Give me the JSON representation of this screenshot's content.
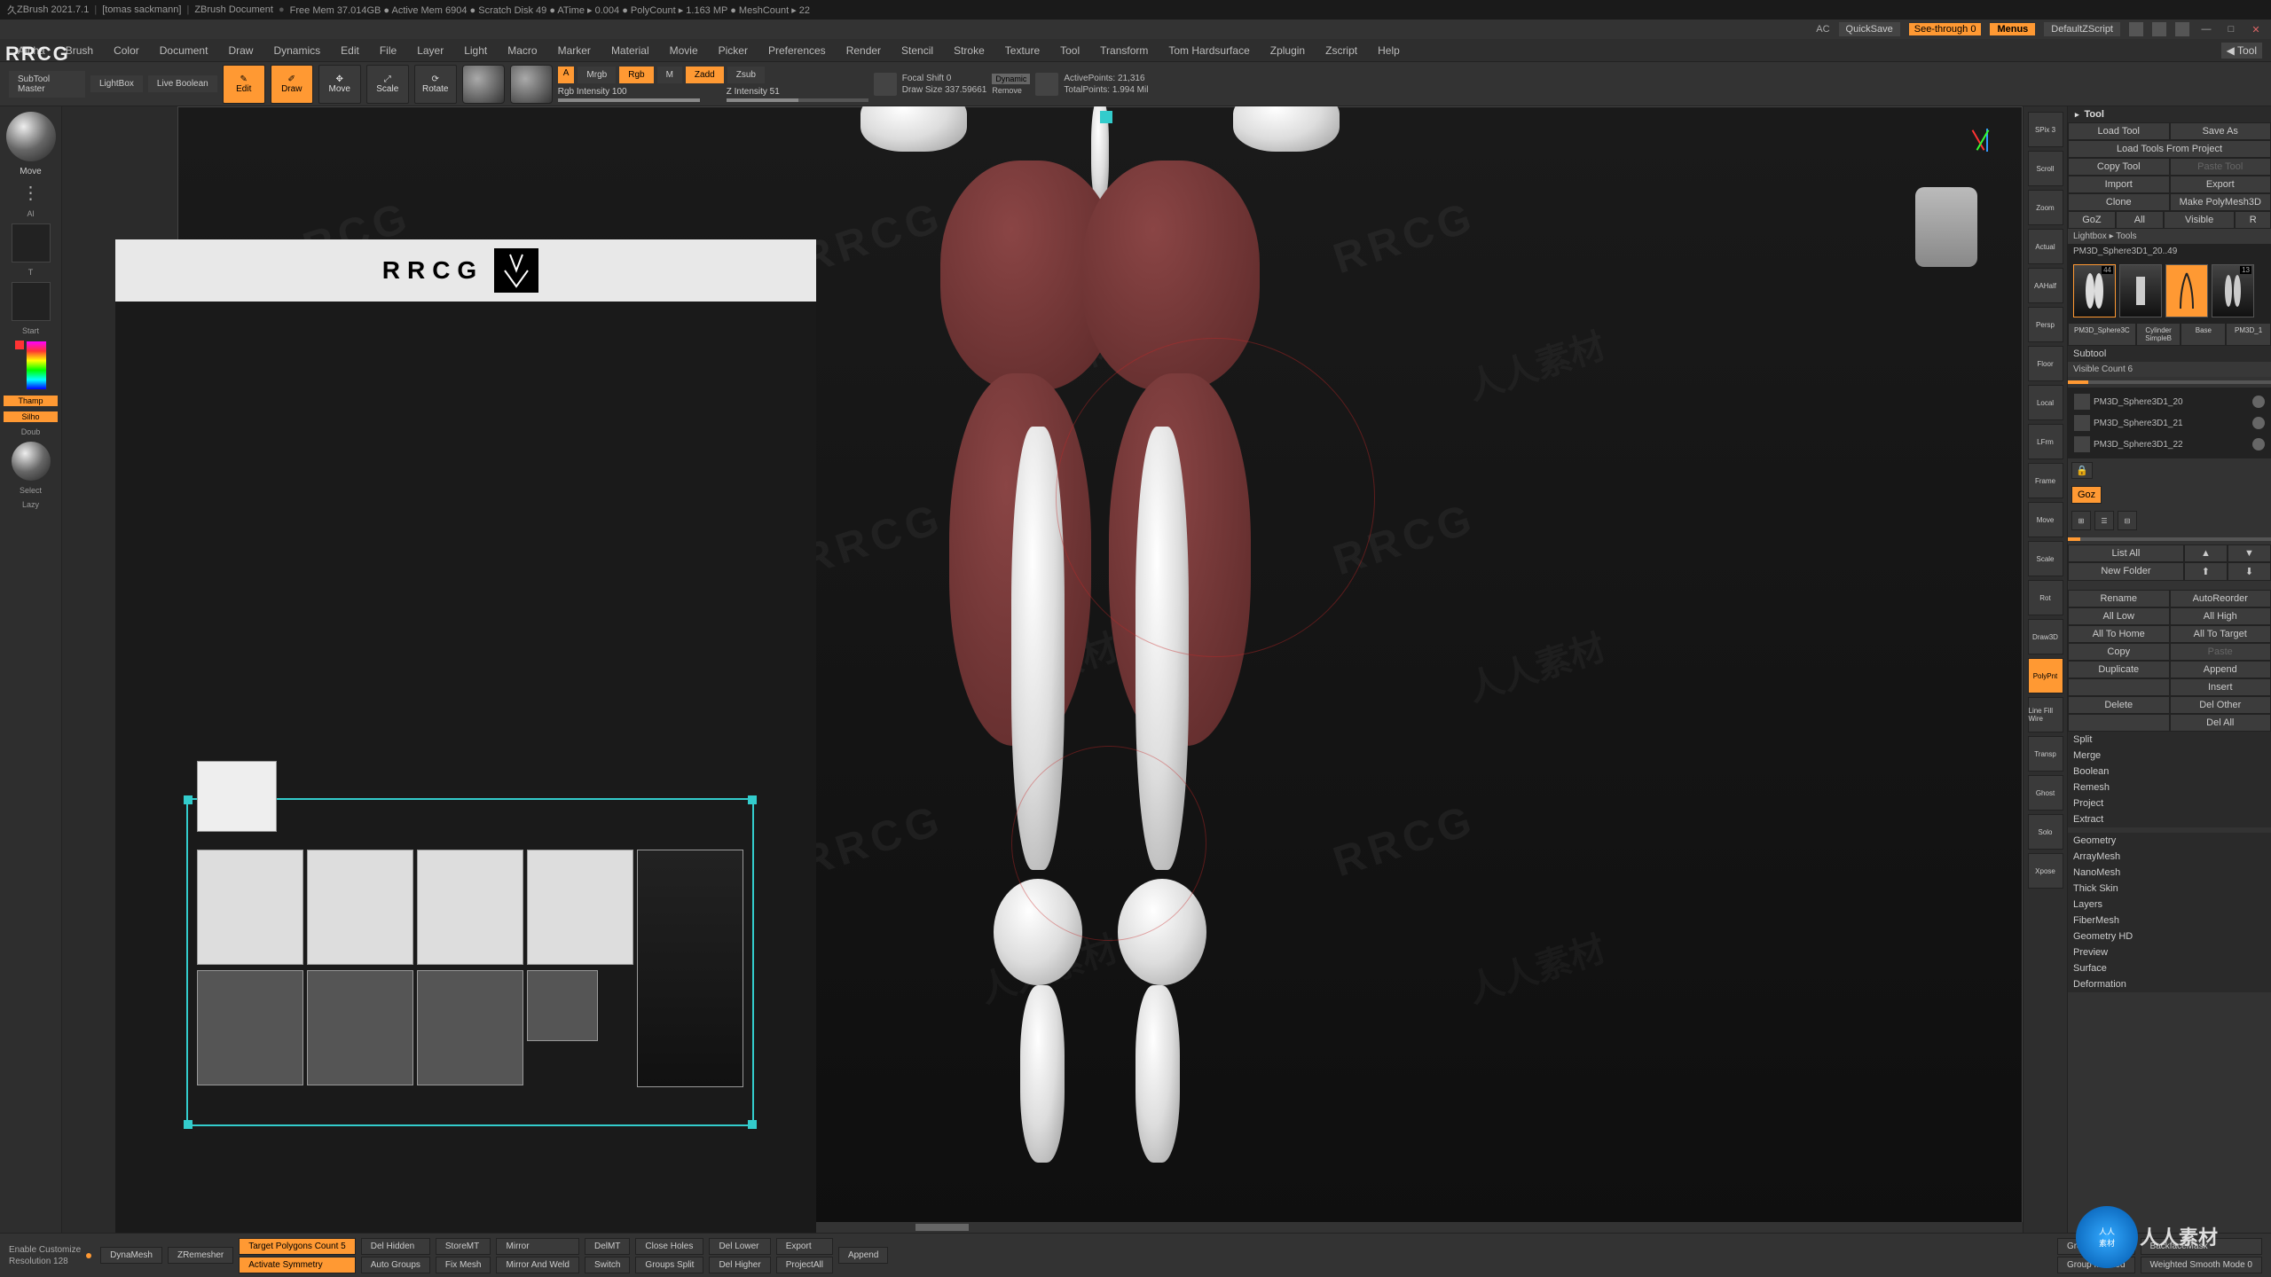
{
  "titlebar": {
    "app": "ZBrush 2021.7.1",
    "user": "[tomas sackmann]",
    "doc": "ZBrush Document",
    "stats": "Free Mem 37.014GB ● Active Mem 6904 ● Scratch Disk 49 ● ATime ▸ 0.004 ● PolyCount ▸ 1.163 MP ● MeshCount ▸ 22"
  },
  "topstrip": {
    "ac": "AC",
    "quicksave": "QuickSave",
    "seethrough": "See-through  0",
    "menus": "Menus",
    "default": "DefaultZScript"
  },
  "menubar": [
    "Alpha",
    "Brush",
    "Color",
    "Document",
    "Draw",
    "Dynamics",
    "Edit",
    "File",
    "Layer",
    "Light",
    "Macro",
    "Marker",
    "Material",
    "Movie",
    "Picker",
    "Preferences",
    "Render",
    "Stencil",
    "Stroke",
    "Texture",
    "Tool",
    "Transform",
    "Tom Hardsurface",
    "Zplugin",
    "Zscript",
    "Help"
  ],
  "menuright": {
    "tool": "Tool"
  },
  "toolrow": {
    "subtoolmaster": "SubTool\nMaster",
    "lightbox": "LightBox",
    "liveboolean": "Live Boolean",
    "edit": "Edit",
    "draw": "Draw",
    "move": "Move",
    "scale": "Scale",
    "rotate": "Rotate",
    "mrgb": "Mrgb",
    "rgb": "Rgb",
    "m": "M",
    "zadd": "Zadd",
    "zsub": "Zsub",
    "a": "A",
    "rgbintensity": "Rgb Intensity 100",
    "zintensity": "Z Intensity 51",
    "focalshift": "Focal Shift 0",
    "drawsize": "Draw Size 337.59661",
    "dynamic": "Dynamic",
    "remove": "Remove",
    "activepoints": "ActivePoints: 21,316",
    "totalpoints": "TotalPoints: 1.994 Mil"
  },
  "watermarks": {
    "rrcg": "RRCG",
    "cn": "人人素材"
  },
  "left": {
    "brush": "Move",
    "al": "Al",
    "t": "T",
    "start": "Start",
    "thamp": "Thamp",
    "silho": "Silho",
    "doub": "Doub",
    "select": "Select",
    "lazy": "Lazy"
  },
  "riconcol": [
    "SPix 3",
    "Scroll",
    "Zoom",
    "Actual",
    "AAHalf",
    "Persp",
    "Floor",
    "Local",
    "LFrm",
    "Frame",
    "Move",
    "Scale",
    "Rot",
    "Draw3D",
    "PolyPnt",
    "Line Fill Wire",
    "Transp",
    "Ghost",
    "Solo",
    "Xpose"
  ],
  "riconcol_active": [
    14
  ],
  "rpanel": {
    "title": "Tool",
    "row1": [
      "Load Tool",
      "Save As"
    ],
    "row2": [
      "Load Tools From Project"
    ],
    "row3": [
      "Copy Tool",
      "Paste Tool"
    ],
    "row4": [
      "Import",
      "Export"
    ],
    "row5": [
      "Clone",
      "Make PolyMesh3D"
    ],
    "row6": [
      "GoZ",
      "All",
      "Visible",
      "R"
    ],
    "lightbox": "Lightbox ▸ Tools",
    "currenttool": "PM3D_Sphere3D1_20..49",
    "thumbs": [
      {
        "count": "44",
        "sel": true
      },
      {
        "count": "",
        "sel": false
      },
      {
        "count": "",
        "sel": false
      },
      {
        "count": "13",
        "sel": false
      }
    ],
    "thumblabels": [
      "PM3D_Sphere3C",
      "Cylinder SimpleB",
      "Base",
      "PM3D_1"
    ],
    "subtool": "Subtool",
    "visiblecount": "Visible Count 6",
    "subtools": [
      "PM3D_Sphere3D1_20",
      "PM3D_Sphere3D1_21",
      "PM3D_Sphere3D1_22"
    ],
    "goz": "Goz",
    "listall": "List All",
    "newfolder": "New Folder",
    "btns": [
      [
        "Rename",
        "AutoReorder"
      ],
      [
        "All Low",
        "All High"
      ],
      [
        "All To Home",
        "All To Target"
      ],
      [
        "Copy",
        "Paste"
      ],
      [
        "Duplicate",
        "Append"
      ],
      [
        "",
        "Insert"
      ],
      [
        "Delete",
        "Del Other"
      ],
      [
        "",
        "Del All"
      ]
    ],
    "secs": [
      "Split",
      "Merge",
      "Boolean",
      "Remesh",
      "Project",
      "Extract"
    ],
    "secs2": [
      "Geometry",
      "ArrayMesh",
      "NanoMesh",
      "Thick Skin",
      "Layers",
      "FiberMesh",
      "Geometry HD",
      "Preview",
      "Surface",
      "Deformation"
    ]
  },
  "bottombar": {
    "enablecust": "Enable Customize",
    "resolution": "Resolution 128",
    "dynamesh": "DynaMesh",
    "zremesher": "ZRemesher",
    "targetpoly": "Target Polygons Count 5",
    "actsym": "Activate Symmetry",
    "delhidden": "Del Hidden",
    "autogroups": "Auto Groups",
    "storemt": "StoreMT",
    "fixmesh": "Fix Mesh",
    "mirror": "Mirror",
    "mirrorweld": "Mirror And Weld",
    "delm": "DelMT",
    "switch": "Switch",
    "closeholes": "Close Holes",
    "groupssplit": "Groups Split",
    "dellower": "Del Lower",
    "delhigher": "Del Higher",
    "export": "Export",
    "projectall": "ProjectAll",
    "append": "Append",
    "groupvisible": "GroupVisible",
    "groupmasked": "Group Masked",
    "backfacemask": "BackfaceMask",
    "weightedsmooth": "Weighted Smooth Mode 0"
  },
  "rrcg": {
    "header": "RRCG"
  },
  "chart_data": null
}
